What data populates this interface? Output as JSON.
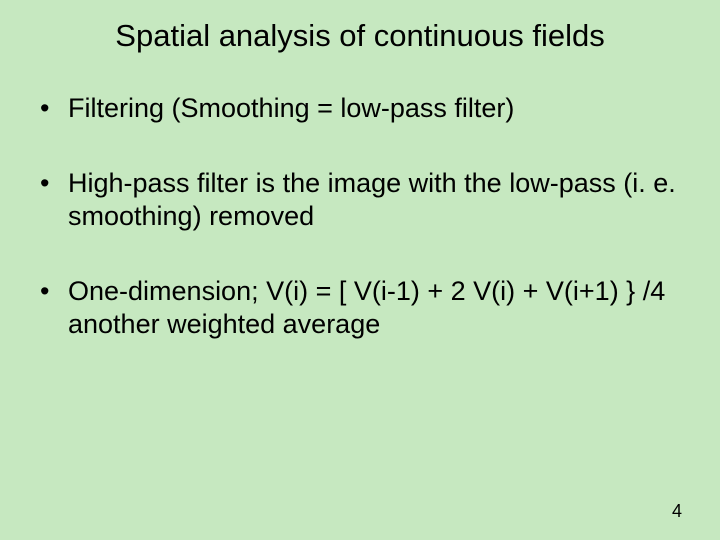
{
  "slide": {
    "title": "Spatial analysis of continuous fields",
    "bullets": [
      "Filtering (Smoothing = low-pass filter)",
      "High-pass filter is the image with the low-pass (i. e. smoothing) removed",
      "One-dimension; V(i) = [ V(i-1) + 2 V(i) + V(i+1) } /4 another weighted average"
    ],
    "page_number": "4"
  }
}
